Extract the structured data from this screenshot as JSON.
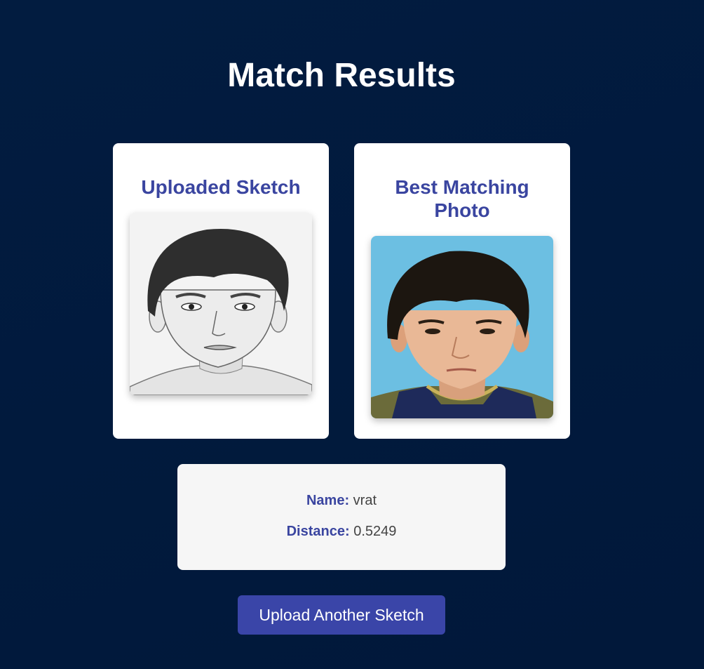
{
  "page": {
    "title": "Match Results"
  },
  "sketch_card": {
    "title": "Uploaded Sketch",
    "image": "pencil-sketch-portrait"
  },
  "match_card": {
    "title": "Best Matching Photo",
    "image": "portrait-photo"
  },
  "result": {
    "name_label": "Name:",
    "name_value": "vrat",
    "distance_label": "Distance:",
    "distance_value": "0.5249"
  },
  "actions": {
    "upload_another_label": "Upload Another Sketch"
  },
  "colors": {
    "accent": "#3a45a0",
    "button": "#3a45a8",
    "background": "#021c40",
    "photo_bg": "#6cbfe2"
  }
}
